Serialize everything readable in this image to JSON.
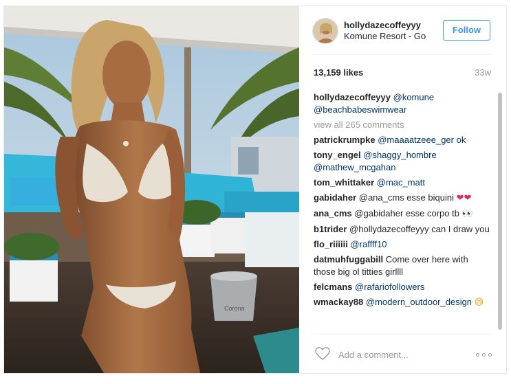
{
  "post": {
    "username": "hollydazecoffeyyy",
    "location": "Komune Resort - Gold Coast",
    "follow_label": "Follow",
    "likes": "13,159 likes",
    "age": "33w",
    "view_all": "view all 265 comments",
    "add_comment_placeholder": "Add a comment...",
    "photo_brand_text": "Corona",
    "caption": {
      "user": "hollydazecoffeyyy",
      "text": "@komune @beachbabeswimwear"
    },
    "comments": [
      {
        "user": "patrickrumpke",
        "text": "@maaaatzeee_ger ok"
      },
      {
        "user": "tony_engel",
        "text": "@shaggy_hombre @mathew_mcgahan"
      },
      {
        "user": "tom_whittaker",
        "text": "@mac_matt"
      },
      {
        "user": "gabidaher",
        "text": "@ana_cms esse biquini",
        "emoji": "❤❤"
      },
      {
        "user": "ana_cms",
        "text": "@gabidaher esse corpo tb",
        "emoji": "👀"
      },
      {
        "user": "b1trider",
        "text": "@hollydazecoffeyyy can I draw you"
      },
      {
        "user": "flo_riiiiii",
        "text": "@raffff10"
      },
      {
        "user": "datmuhfuggabill",
        "text": "Come over here with those big ol titties girllll"
      },
      {
        "user": "felcmans",
        "text": "@rafariofollowers"
      },
      {
        "user": "wmackay88",
        "text": "@modern_outdoor_design",
        "emoji": "😅"
      }
    ]
  },
  "icons": [
    "heart-icon",
    "more-options-icon"
  ],
  "colors": {
    "accent": "#3897f0",
    "mention": "#003569",
    "muted": "#999999",
    "border": "#efefef"
  }
}
